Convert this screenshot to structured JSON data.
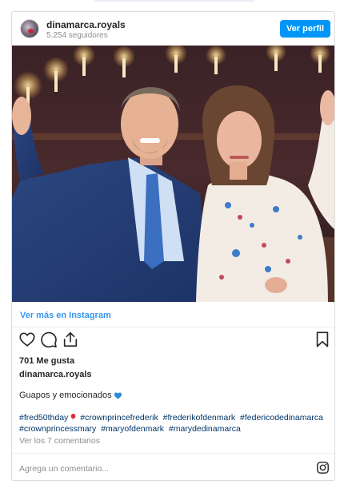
{
  "header": {
    "username": "dinamarca.royals",
    "followers": "5.254 seguidores",
    "profile_button": "Ver perfil"
  },
  "more_link": "Ver más en Instagram",
  "actions": {
    "icons": [
      "heart-icon",
      "comment-icon",
      "share-icon",
      "bookmark-icon"
    ]
  },
  "likes": "701 Me gusta",
  "caption": {
    "username": "dinamarca.royals",
    "text": "Guapos y emocionados"
  },
  "hashtags": [
    "#fred50thday",
    "#crownprincefrederik",
    "#frederikofdenmark",
    "#federicodedinamarca",
    "#crownprincessmary",
    "#maryofdenmark",
    "#marydedinamarca"
  ],
  "comments_link": "Ver los 7 comentarios",
  "comment_box": {
    "placeholder": "Agrega un comentario..."
  },
  "colors": {
    "accent": "#0095f6",
    "link": "#3897f0",
    "hashtag": "#003569",
    "muted": "#8e8e8e",
    "text": "#262626"
  }
}
